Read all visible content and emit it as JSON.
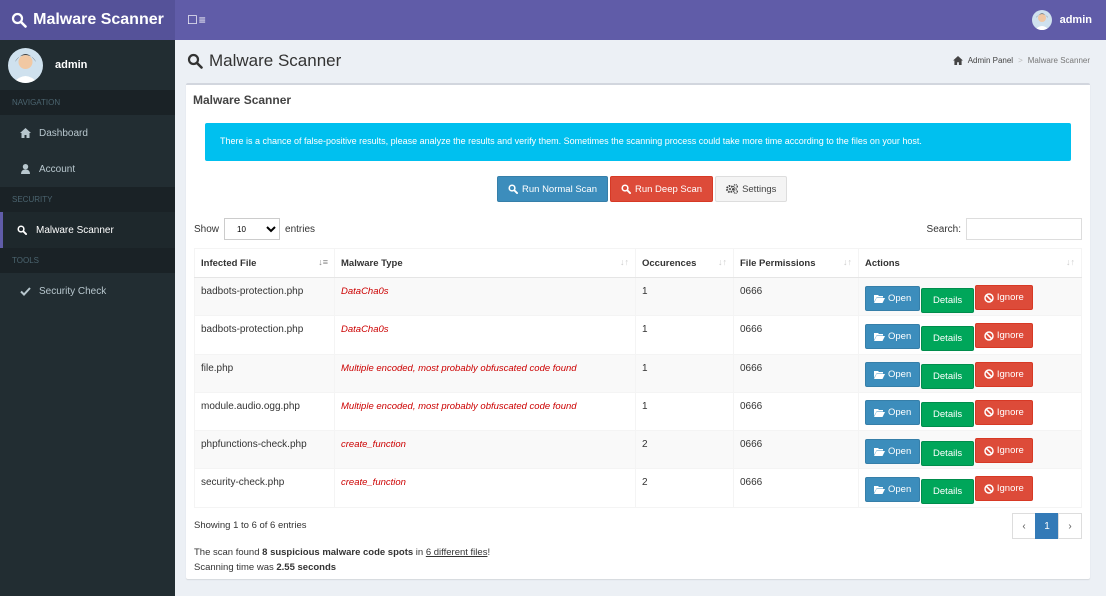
{
  "app": {
    "brand": "Malware Scanner",
    "toggle_icon": "☐≡"
  },
  "header": {
    "user": "admin"
  },
  "sidebar": {
    "user": "admin",
    "sections": [
      {
        "header": "NAVIGATION",
        "items": [
          {
            "label": "Dashboard",
            "icon": "home-icon"
          },
          {
            "label": "Account",
            "icon": "user-icon"
          }
        ]
      },
      {
        "header": "SECURITY",
        "items": [
          {
            "label": "Malware Scanner",
            "icon": "search-icon",
            "active": true
          }
        ]
      },
      {
        "header": "TOOLS",
        "items": [
          {
            "label": "Security Check",
            "icon": "check-icon"
          }
        ]
      }
    ]
  },
  "page": {
    "title": "Malware Scanner",
    "breadcrumb": {
      "home": "Admin Panel",
      "current": "Malware Scanner"
    }
  },
  "box": {
    "title": "Malware Scanner",
    "callout": "There is a chance of false-positive results, please analyze the results and verify them. Sometimes the scanning process could take more time according to the files on your host.",
    "buttons": {
      "normal": "Run Normal Scan",
      "deep": "Run Deep Scan",
      "settings": "Settings"
    }
  },
  "table_controls": {
    "show_label": "Show",
    "entries_value": "10",
    "entries_label": "entries",
    "search_label": "Search:"
  },
  "table": {
    "columns": [
      "Infected File",
      "Malware Type",
      "Occurences",
      "File Permissions",
      "Actions"
    ],
    "rows": [
      {
        "file": "badbots-protection.php",
        "type": "DataCha0s",
        "occ": "1",
        "perm": "0666"
      },
      {
        "file": "badbots-protection.php",
        "type": "DataCha0s",
        "occ": "1",
        "perm": "0666"
      },
      {
        "file": "file.php",
        "type": "Multiple encoded, most probably obfuscated code found",
        "occ": "1",
        "perm": "0666"
      },
      {
        "file": "module.audio.ogg.php",
        "type": "Multiple encoded, most probably obfuscated code found",
        "occ": "1",
        "perm": "0666"
      },
      {
        "file": "phpfunctions-check.php",
        "type": "create_function",
        "occ": "2",
        "perm": "0666"
      },
      {
        "file": "security-check.php",
        "type": "create_function",
        "occ": "2",
        "perm": "0666"
      }
    ],
    "action_labels": {
      "open": "Open",
      "details": "Details",
      "ignore": "Ignore"
    }
  },
  "footer": {
    "info": "Showing 1 to 6 of 6 entries",
    "pager": {
      "prev": "‹",
      "page": "1",
      "next": "›"
    },
    "summary": {
      "prefix": "The scan found ",
      "spots": "8 suspicious malware code spots",
      "mid": " in ",
      "files": "6 different files",
      "suffix": "!",
      "time_prefix": "Scanning time was ",
      "time": "2.55 seconds"
    }
  },
  "colors": {
    "header": "#605ca8",
    "logo": "#555299",
    "sidebar": "#222d32",
    "callout": "#00c0ef",
    "primary": "#3c8dbc",
    "danger": "#dd4b39",
    "success": "#00a65a"
  }
}
